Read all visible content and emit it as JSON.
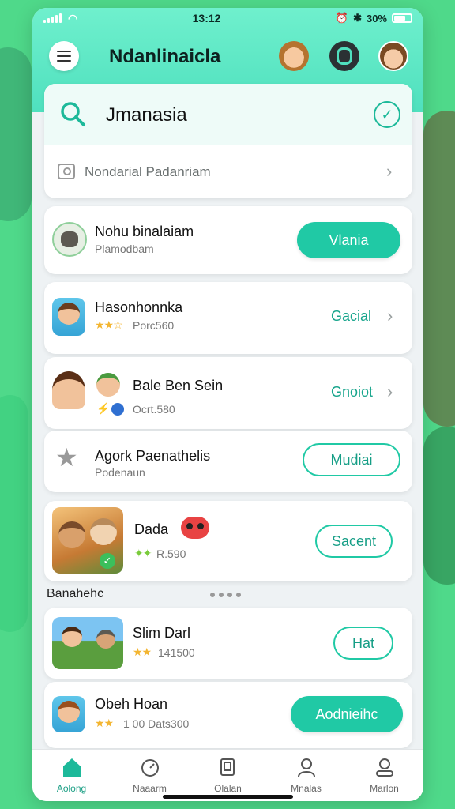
{
  "status": {
    "time": "13:12",
    "battery": "30%"
  },
  "header": {
    "title": "Ndanlinaicla"
  },
  "search": {
    "query": "Jmanasia",
    "suggestion": "Nondarial Padanriam"
  },
  "items": [
    {
      "title": "Nohu binalaiam",
      "subtitle": "Plamodbam",
      "action": "Vlania"
    },
    {
      "title": "Hasonhonnka",
      "subtitle": "Porc560",
      "action": "Gacial"
    },
    {
      "title": "Bale Ben Sein",
      "subtitle": "Ocrt.580",
      "action": "Gnoiot"
    },
    {
      "title": "Agork Paenathelis",
      "subtitle": "Podenaun",
      "action": "Mudiai"
    },
    {
      "title": "Dada",
      "subtitle": "R.590",
      "action": "Sacent"
    }
  ],
  "section": {
    "label": "Banahehc"
  },
  "items2": [
    {
      "title": "Slim Darl",
      "subtitle": "141500",
      "action": "Hat"
    },
    {
      "title": "Obeh Hoan",
      "subtitle": "1 00 Dats300",
      "action": "Aodnieihc"
    }
  ],
  "nav": [
    {
      "label": "Aolong",
      "icon": "home-icon"
    },
    {
      "label": "Naaarm",
      "icon": "timer-icon"
    },
    {
      "label": "Olalan",
      "icon": "copy-icon"
    },
    {
      "label": "Mnalas",
      "icon": "user-icon"
    },
    {
      "label": "Marlon",
      "icon": "profile-icon"
    }
  ],
  "colors": {
    "accent": "#20c9a5",
    "header": "#6ff0cd",
    "background": "#4fd98a"
  }
}
